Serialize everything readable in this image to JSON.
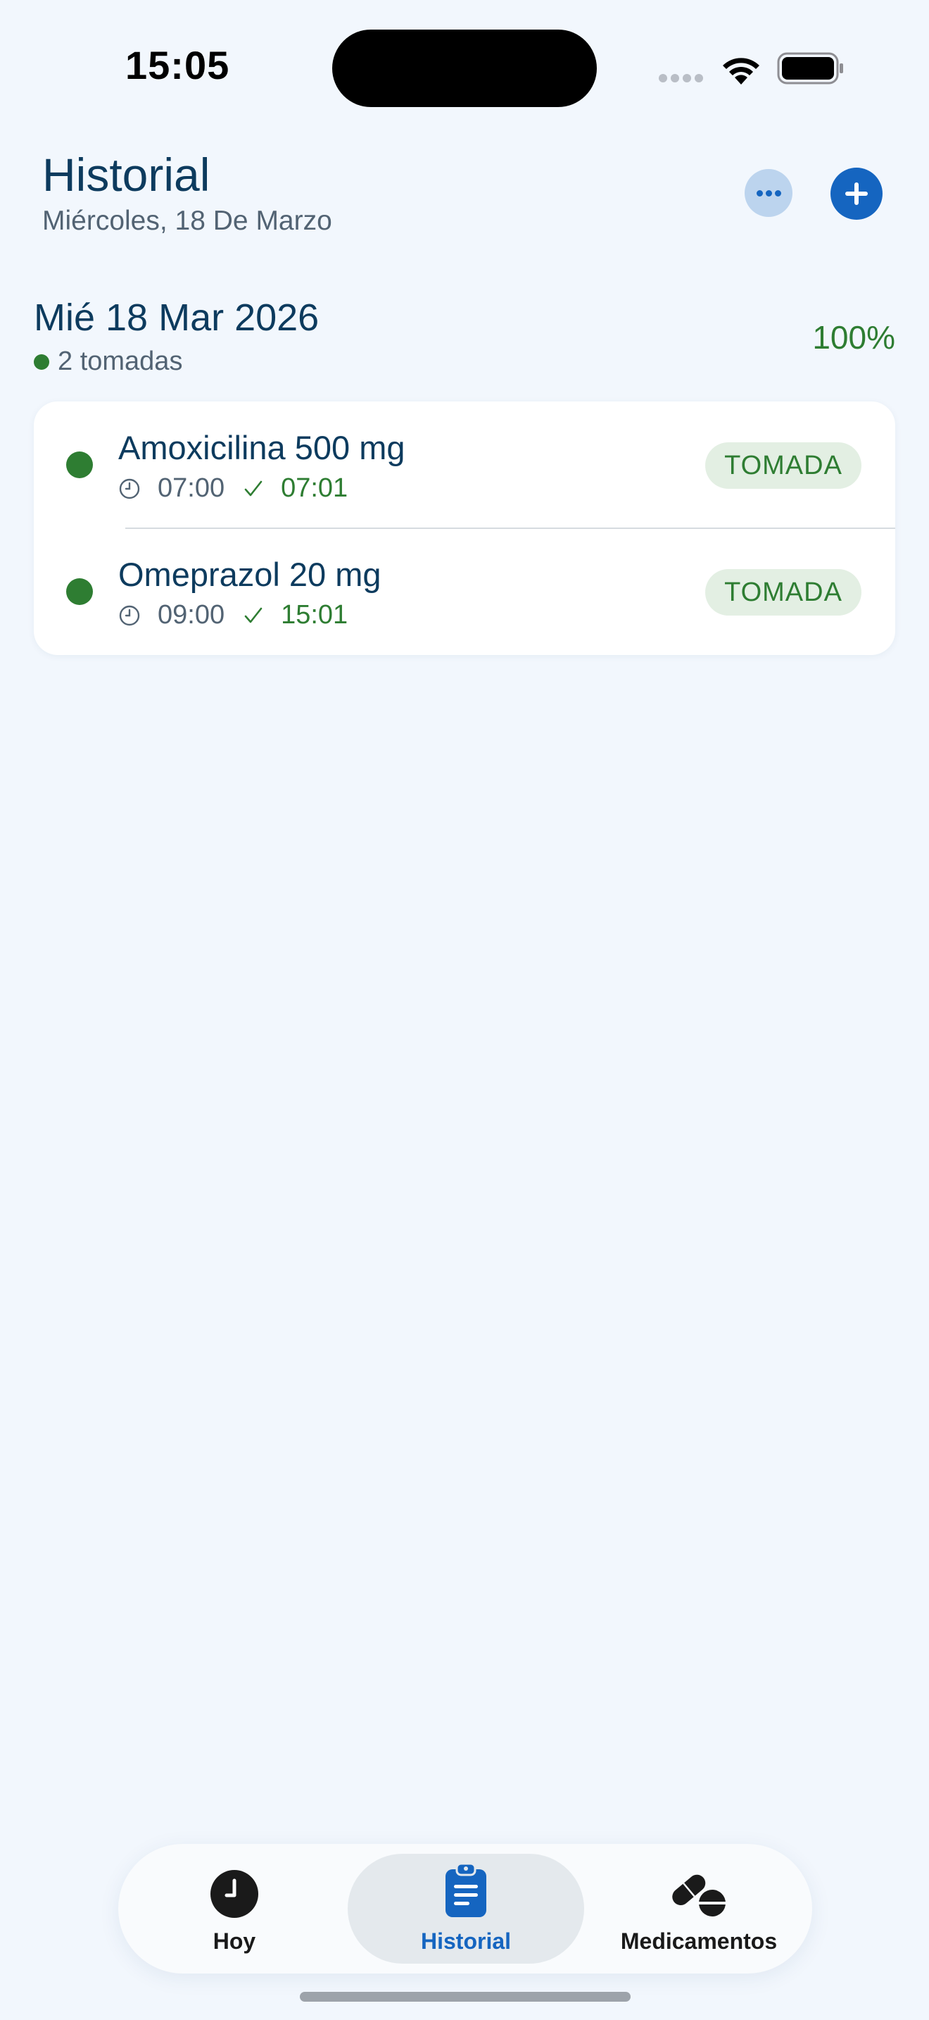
{
  "status_bar": {
    "time": "15:05"
  },
  "header": {
    "title": "Historial",
    "subtitle": "Miércoles, 18 De Marzo",
    "more_icon": "ellipsis-icon",
    "add_icon": "plus-icon"
  },
  "day": {
    "title": "Mié 18 Mar 2026",
    "summary": "2 tomadas",
    "percentage": "100%"
  },
  "doses": [
    {
      "name": "Amoxicilina 500 mg",
      "scheduled": "07:00",
      "taken": "07:01",
      "status": "TOMADA"
    },
    {
      "name": "Omeprazol 20 mg",
      "scheduled": "09:00",
      "taken": "15:01",
      "status": "TOMADA"
    }
  ],
  "tab_bar": {
    "tabs": [
      {
        "label": "Hoy",
        "icon": "clock-icon"
      },
      {
        "label": "Historial",
        "icon": "clipboard-icon",
        "selected": true
      },
      {
        "label": "Medicamentos",
        "icon": "pills-icon"
      }
    ]
  },
  "colors": {
    "background": "#f2f7fd",
    "primary": "#1565c0",
    "title": "#0d3b5e",
    "success": "#2e7d32",
    "badge_bg": "#e3efe3"
  }
}
